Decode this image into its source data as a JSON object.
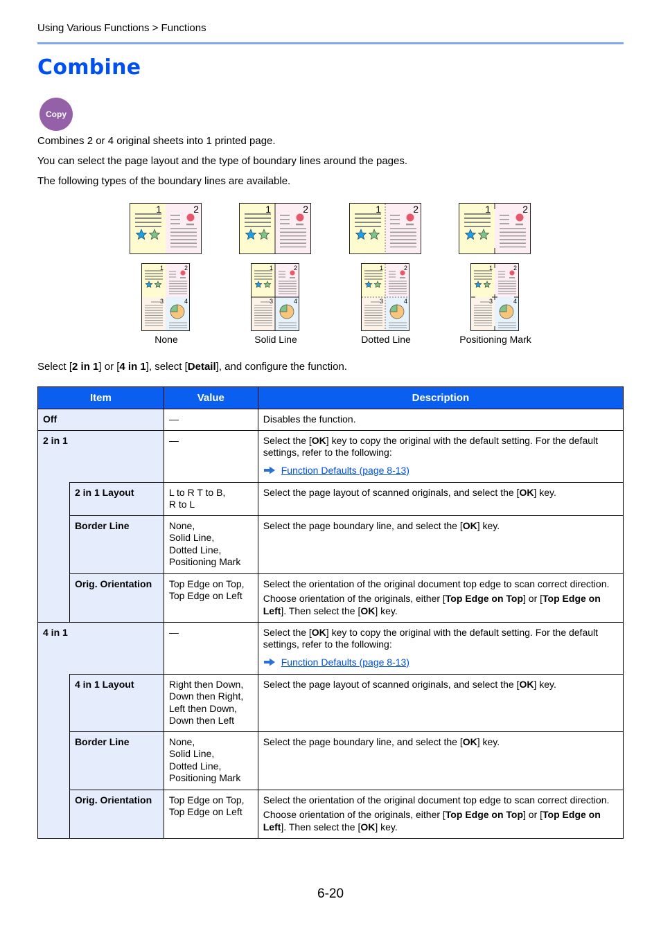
{
  "breadcrumb": "Using Various Functions > Functions",
  "title": "Combine",
  "badge": "Copy",
  "paragraphs": [
    "Combines 2 or 4 original sheets into 1 printed page.",
    "You can select the page layout and the type of boundary lines around the pages.",
    "The following types of the boundary lines are available."
  ],
  "figures": [
    {
      "label": "None",
      "border": "none"
    },
    {
      "label": "Solid Line",
      "border": "solid"
    },
    {
      "label": "Dotted Line",
      "border": "dotted"
    },
    {
      "label": "Positioning Mark",
      "border": "mark"
    }
  ],
  "figure_page_numbers": [
    "1",
    "2",
    "3",
    "4"
  ],
  "intro": {
    "pre": "Select [",
    "b1": "2 in 1",
    "mid1": "] or [",
    "b2": "4 in 1",
    "mid2": "], select [",
    "b3": "Detail",
    "post": "], and configure the function."
  },
  "table": {
    "headers": [
      "Item",
      "Value",
      "Description"
    ],
    "off": {
      "item": "Off",
      "value": "—",
      "description": "Disables the function."
    },
    "two_in_one": {
      "item": "2 in 1",
      "value": "—",
      "desc_pre": "Select the [",
      "desc_ok": "OK",
      "desc_post": "] key to copy the original with the default setting. For the default settings, refer to the following:",
      "link": "Function Defaults (page 8-13)",
      "subs": {
        "layout": {
          "item": "2 in 1 Layout",
          "value": "L to R T to B,\nR to L",
          "desc_pre": "Select the page layout of scanned originals, and select the [",
          "desc_ok": "OK",
          "desc_post": "] key."
        },
        "border": {
          "item": "Border Line",
          "value": "None,\nSolid Line,\nDotted Line,\nPositioning Mark",
          "desc_pre": "Select the page boundary line, and select the [",
          "desc_ok": "OK",
          "desc_post": "] key."
        },
        "orientation": {
          "item": "Orig. Orientation",
          "value": "Top Edge on Top,\nTop Edge on Left",
          "desc_line1": "Select the orientation of the original document top edge to scan correct direction.",
          "desc2_pre": "Choose orientation of the originals, either [",
          "desc2_b1": "Top Edge on Top",
          "desc2_mid": "] or [",
          "desc2_b2": "Top Edge on Left",
          "desc2_mid2": "]. Then select the [",
          "desc2_ok": "OK",
          "desc2_post": "] key."
        }
      }
    },
    "four_in_one": {
      "item": "4 in 1",
      "value": "—",
      "desc_pre": "Select the [",
      "desc_ok": "OK",
      "desc_post": "] key to copy the original with the default setting. For the default settings, refer to the following:",
      "link": "Function Defaults (page 8-13)",
      "subs": {
        "layout": {
          "item": "4 in 1 Layout",
          "value": "Right then Down,\nDown then Right,\nLeft then Down,\nDown then Left",
          "desc_pre": "Select the page layout of scanned originals, and select the [",
          "desc_ok": "OK",
          "desc_post": "] key."
        },
        "border": {
          "item": "Border Line",
          "value": "None,\nSolid Line,\nDotted Line,\nPositioning Mark",
          "desc_pre": "Select the page boundary line, and select the [",
          "desc_ok": "OK",
          "desc_post": "] key."
        },
        "orientation": {
          "item": "Orig. Orientation",
          "value": "Top Edge on Top,\nTop Edge on Left",
          "desc_line1": "Select the orientation of the original document top edge to scan correct direction.",
          "desc2_pre": "Choose orientation of the originals, either [",
          "desc2_b1": "Top Edge on Top",
          "desc2_mid": "] or [",
          "desc2_b2": "Top Edge on Left",
          "desc2_mid2": "]. Then select the [",
          "desc2_ok": "OK",
          "desc2_post": "] key."
        }
      }
    }
  },
  "page_number": "6-20",
  "colors": {
    "title": "#0050f0",
    "rule": "#7fa8f0",
    "badge": "#9460a8",
    "header_bg": "#0a5ff0",
    "item_bg": "#e5ecfc",
    "link": "#0050e0",
    "page1_bg": "#fffbd0",
    "page2_bg": "#fdeef4",
    "page3_bg": "#fdf3e8",
    "page4_bg": "#e6f2fc"
  }
}
